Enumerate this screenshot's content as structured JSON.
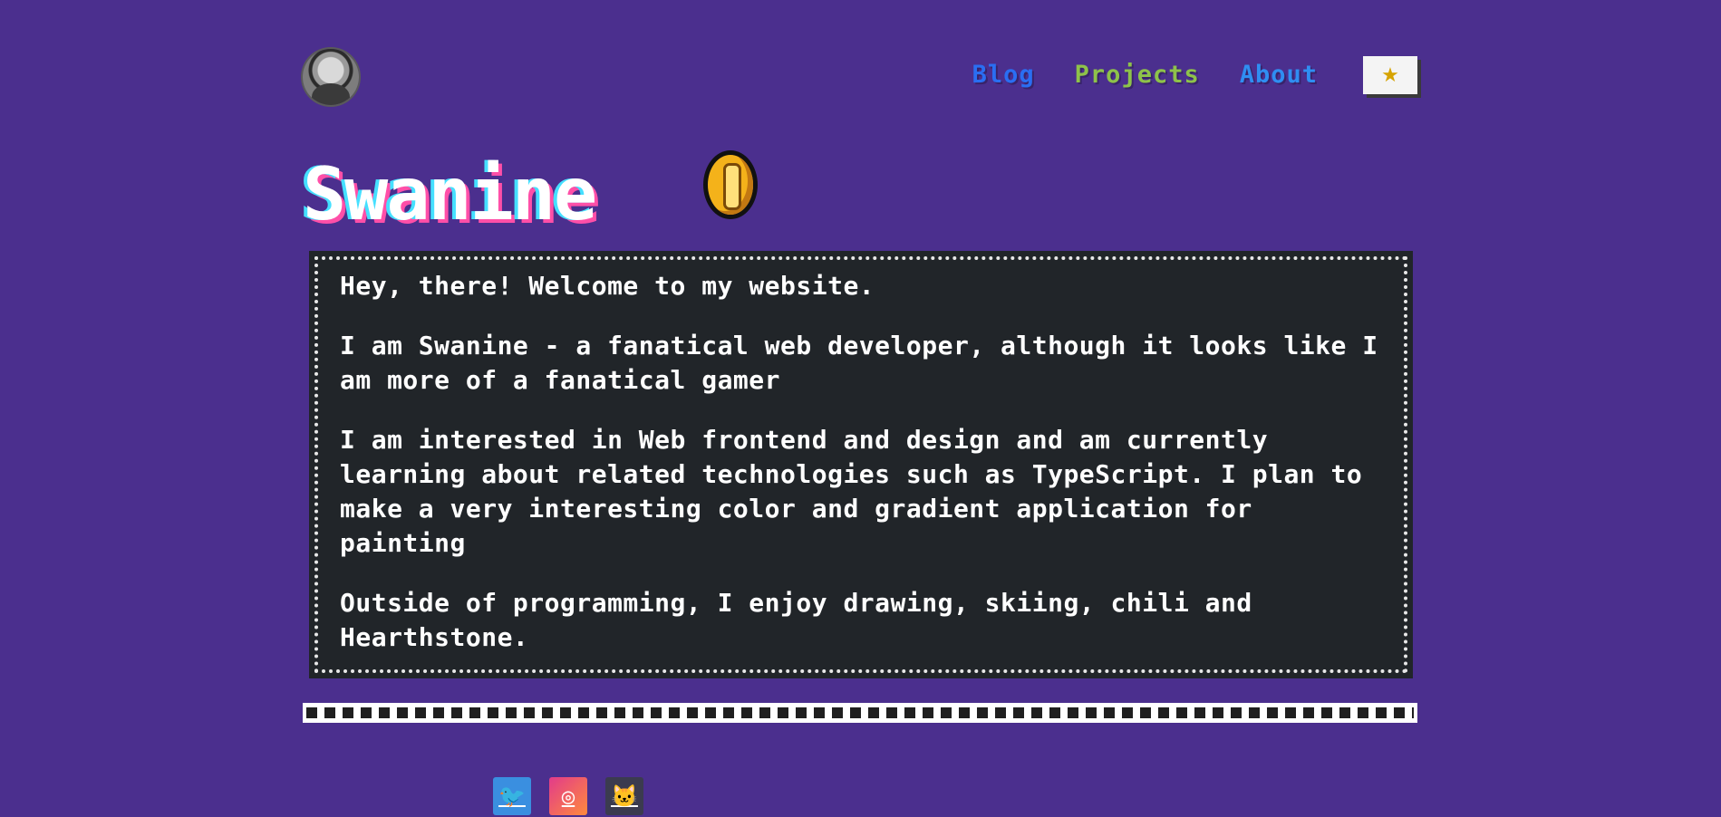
{
  "header": {
    "avatar_alt": "avatar",
    "nav": [
      {
        "label": "Blog",
        "color": "#2a6ef2"
      },
      {
        "label": "Projects",
        "color": "#8ec24a"
      },
      {
        "label": "About",
        "color": "#2f8ef2"
      }
    ],
    "theme_button_icon": "star-icon",
    "theme_button_glyph": "★"
  },
  "title": {
    "text": "Swanine",
    "badge_icon": "coin-icon"
  },
  "content": {
    "paragraphs": [
      "Hey, there! Welcome to my website.",
      "I am Swanine - a fanatical web developer, although it looks like I am more of a fanatical gamer",
      "I am interested in Web frontend and design and am currently learning about related technologies such as TypeScript. I plan to make a very interesting color and gradient application for painting",
      "Outside of programming, I enjoy drawing, skiing, chili and Hearthstone."
    ]
  },
  "footer": {
    "socials": [
      {
        "name": "twitter-icon",
        "glyph": "🐦"
      },
      {
        "name": "instagram-icon",
        "glyph": "◎"
      },
      {
        "name": "github-icon",
        "glyph": "🐱"
      }
    ]
  },
  "colors": {
    "background": "#4b2f8e",
    "content_box": "#212529",
    "title_shadow_cyan": "#45e0ff",
    "title_shadow_pink": "#ff4fa8"
  }
}
